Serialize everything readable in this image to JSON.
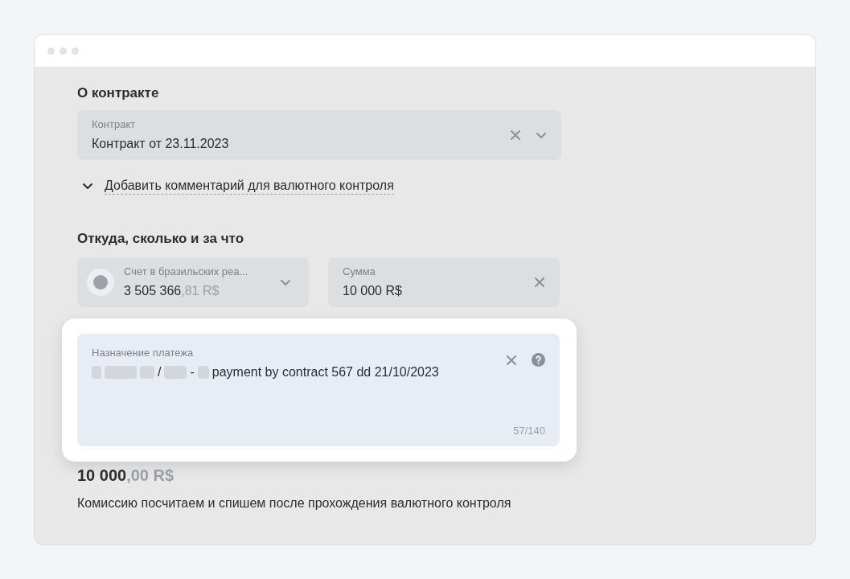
{
  "contract_section": {
    "title": "О контракте",
    "contract_field": {
      "label": "Контракт",
      "value": "Контракт от 23.11.2023"
    },
    "comment_toggle": {
      "label": "Добавить комментарий для валютного контроля",
      "expanded": false
    }
  },
  "payment_section": {
    "title": "Откуда, сколько и за что",
    "account_field": {
      "label": "Счет в бразильских реа...",
      "amount_main": "3 505 366",
      "amount_fraction": ",81 R$"
    },
    "sum_field": {
      "label": "Сумма",
      "value": "10 000 R$"
    },
    "purpose_field": {
      "label": "Назначение платежа",
      "highlighted": true,
      "segments": [
        {
          "kind": "redacted"
        },
        {
          "kind": "redacted"
        },
        {
          "kind": "redacted"
        },
        {
          "kind": "text",
          "text": "/"
        },
        {
          "kind": "redacted"
        },
        {
          "kind": "text",
          "text": "-"
        },
        {
          "kind": "redacted"
        },
        {
          "kind": "text",
          "text": "payment by contract 567 dd 21/10/2023"
        }
      ],
      "counter": "57/140"
    }
  },
  "total": {
    "main": "10 000",
    "fraction": ",00 R$"
  },
  "note": "Комиссию посчитаем и спишем после прохождения валютного контроля"
}
